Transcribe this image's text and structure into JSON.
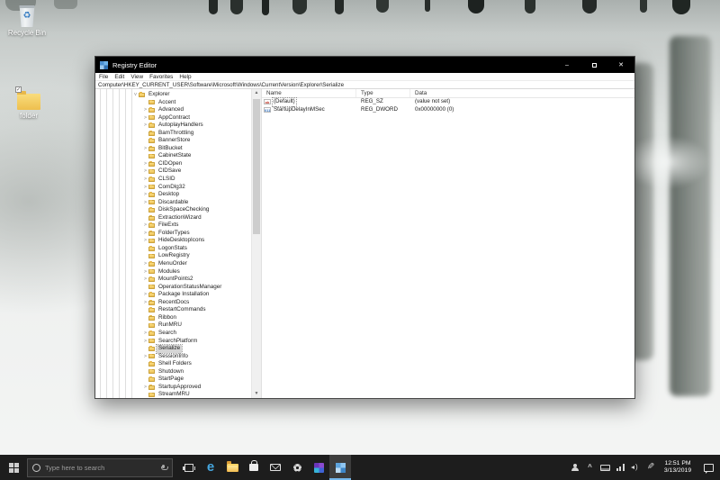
{
  "desktop": {
    "icons": [
      {
        "label": "Recycle Bin"
      },
      {
        "label": "folder"
      }
    ]
  },
  "window": {
    "title": "Registry Editor",
    "menu": [
      "File",
      "Edit",
      "View",
      "Favorites",
      "Help"
    ],
    "address": "Computer\\HKEY_CURRENT_USER\\Software\\Microsoft\\Windows\\CurrentVersion\\Explorer\\Serialize",
    "controls": {
      "minimize": "–",
      "close": "✕"
    },
    "tree": {
      "items": [
        {
          "label": "Explorer",
          "lvl": 0,
          "chev": "v",
          "sel": false
        },
        {
          "label": "Accent",
          "lvl": 1,
          "chev": "",
          "sel": false
        },
        {
          "label": "Advanced",
          "lvl": 1,
          "chev": ">",
          "sel": false
        },
        {
          "label": "AppContract",
          "lvl": 1,
          "chev": ">",
          "sel": false
        },
        {
          "label": "AutoplayHandlers",
          "lvl": 1,
          "chev": ">",
          "sel": false
        },
        {
          "label": "BamThrottling",
          "lvl": 1,
          "chev": "",
          "sel": false
        },
        {
          "label": "BannerStore",
          "lvl": 1,
          "chev": "",
          "sel": false
        },
        {
          "label": "BitBucket",
          "lvl": 1,
          "chev": ">",
          "sel": false
        },
        {
          "label": "CabinetState",
          "lvl": 1,
          "chev": "",
          "sel": false
        },
        {
          "label": "CIDOpen",
          "lvl": 1,
          "chev": ">",
          "sel": false
        },
        {
          "label": "CIDSave",
          "lvl": 1,
          "chev": ">",
          "sel": false
        },
        {
          "label": "CLSID",
          "lvl": 1,
          "chev": ">",
          "sel": false
        },
        {
          "label": "ComDlg32",
          "lvl": 1,
          "chev": ">",
          "sel": false
        },
        {
          "label": "Desktop",
          "lvl": 1,
          "chev": ">",
          "sel": false
        },
        {
          "label": "Discardable",
          "lvl": 1,
          "chev": ">",
          "sel": false
        },
        {
          "label": "DiskSpaceChecking",
          "lvl": 1,
          "chev": "",
          "sel": false
        },
        {
          "label": "ExtractionWizard",
          "lvl": 1,
          "chev": "",
          "sel": false
        },
        {
          "label": "FileExts",
          "lvl": 1,
          "chev": ">",
          "sel": false
        },
        {
          "label": "FolderTypes",
          "lvl": 1,
          "chev": ">",
          "sel": false
        },
        {
          "label": "HideDesktopIcons",
          "lvl": 1,
          "chev": ">",
          "sel": false
        },
        {
          "label": "LogonStats",
          "lvl": 1,
          "chev": "",
          "sel": false
        },
        {
          "label": "LowRegistry",
          "lvl": 1,
          "chev": "",
          "sel": false
        },
        {
          "label": "MenuOrder",
          "lvl": 1,
          "chev": ">",
          "sel": false
        },
        {
          "label": "Modules",
          "lvl": 1,
          "chev": ">",
          "sel": false
        },
        {
          "label": "MountPoints2",
          "lvl": 1,
          "chev": ">",
          "sel": false
        },
        {
          "label": "OperationStatusManager",
          "lvl": 1,
          "chev": "",
          "sel": false
        },
        {
          "label": "Package Installation",
          "lvl": 1,
          "chev": ">",
          "sel": false
        },
        {
          "label": "RecentDocs",
          "lvl": 1,
          "chev": ">",
          "sel": false
        },
        {
          "label": "RestartCommands",
          "lvl": 1,
          "chev": "",
          "sel": false
        },
        {
          "label": "Ribbon",
          "lvl": 1,
          "chev": "",
          "sel": false
        },
        {
          "label": "RunMRU",
          "lvl": 1,
          "chev": "",
          "sel": false
        },
        {
          "label": "Search",
          "lvl": 1,
          "chev": ">",
          "sel": false
        },
        {
          "label": "SearchPlatform",
          "lvl": 1,
          "chev": ">",
          "sel": false
        },
        {
          "label": "Serialize",
          "lvl": 1,
          "chev": "",
          "sel": true
        },
        {
          "label": "SessionInfo",
          "lvl": 1,
          "chev": ">",
          "sel": false
        },
        {
          "label": "Shell Folders",
          "lvl": 1,
          "chev": "",
          "sel": false
        },
        {
          "label": "Shutdown",
          "lvl": 1,
          "chev": "",
          "sel": false
        },
        {
          "label": "StartPage",
          "lvl": 1,
          "chev": "",
          "sel": false
        },
        {
          "label": "StartupApproved",
          "lvl": 1,
          "chev": ">",
          "sel": false
        },
        {
          "label": "StreamMRU",
          "lvl": 1,
          "chev": "",
          "sel": false
        }
      ]
    },
    "values": {
      "columns": [
        "Name",
        "Type",
        "Data"
      ],
      "rows": [
        {
          "name": "(Default)",
          "type": "REG_SZ",
          "data": "(value not set)",
          "icon": "string-value-icon",
          "focused": true
        },
        {
          "name": "StartupDelayInMSec",
          "type": "REG_DWORD",
          "data": "0x00000000 (0)",
          "icon": "dword-value-icon",
          "focused": false
        }
      ]
    }
  },
  "taskbar": {
    "search_placeholder": "Type here to search",
    "apps": [
      "task-view",
      "edge",
      "file-explorer",
      "store",
      "mail",
      "settings",
      "office",
      "registry-editor"
    ],
    "active_app": "registry-editor",
    "tray": [
      "people",
      "chevron-up",
      "touch-keyboard",
      "network",
      "volume",
      "pen"
    ],
    "clock": {
      "time": "12:51 PM",
      "date": "3/13/2019"
    }
  }
}
